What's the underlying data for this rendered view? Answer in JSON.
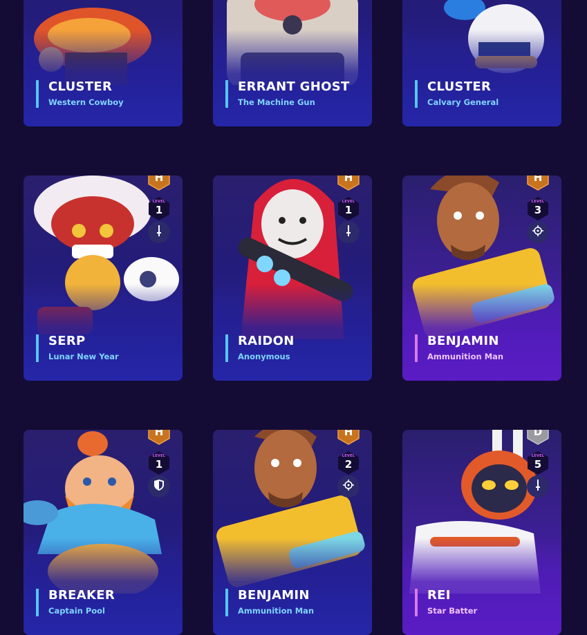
{
  "cards": [
    {
      "name": "CLUSTER",
      "subtitle": "Western Cowboy"
    },
    {
      "name": "ERRANT GHOST",
      "subtitle": "The Machine Gun"
    },
    {
      "name": "CLUSTER",
      "subtitle": "Calvary General"
    },
    {
      "name": "SERP",
      "subtitle": "Lunar New Year",
      "tier": "H",
      "level_label": "LEVEL",
      "level": "1",
      "role_icon": "sword-icon"
    },
    {
      "name": "RAIDON",
      "subtitle": "Anonymous",
      "tier": "H",
      "level_label": "LEVEL",
      "level": "1",
      "role_icon": "sword-icon"
    },
    {
      "name": "BENJAMIN",
      "subtitle": "Ammunition Man",
      "tier": "H",
      "level_label": "LEVEL",
      "level": "3",
      "role_icon": "crosshair-icon"
    },
    {
      "name": "BREAKER",
      "subtitle": "Captain Pool",
      "tier": "H",
      "level_label": "LEVEL",
      "level": "1",
      "role_icon": "shield-icon"
    },
    {
      "name": "BENJAMIN",
      "subtitle": "Ammunition Man",
      "tier": "H",
      "level_label": "LEVEL",
      "level": "2",
      "role_icon": "crosshair-icon"
    },
    {
      "name": "REI",
      "subtitle": "Star Batter",
      "tier": "D",
      "level_label": "LEVEL",
      "level": "5",
      "role_icon": "sword-icon"
    }
  ],
  "colors": {
    "background": "#140c34",
    "tier_h": "#c8741f",
    "tier_d": "#9a9aa0",
    "accent_blue": "#57c6f4",
    "accent_purple": "#d77af2"
  }
}
